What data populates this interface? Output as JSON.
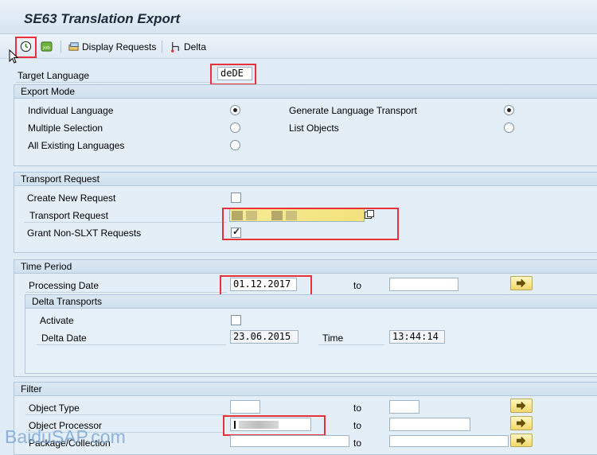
{
  "title": "SE63 Translation Export",
  "toolbar": {
    "display_requests": "Display Requests",
    "delta": "Delta",
    "job_icon_text": "Job"
  },
  "target_language": {
    "label": "Target Language",
    "value": "deDE"
  },
  "export_mode": {
    "header": "Export Mode",
    "individual_language": "Individual Language",
    "multiple_selection": "Multiple Selection",
    "all_existing_languages": "All Existing Languages",
    "generate_language_transport": "Generate Language Transport",
    "list_objects": "List Objects"
  },
  "transport_request": {
    "header": "Transport Request",
    "create_new_request": "Create New Request",
    "transport_request_label": "Transport Request",
    "grant_non_slxt": "Grant Non-SLXT Requests"
  },
  "time_period": {
    "header": "Time Period",
    "processing_date_label": "Processing Date",
    "processing_date": "01.12.2017",
    "to": "to",
    "delta_transports": {
      "header": "Delta Transports",
      "activate": "Activate",
      "delta_date_label": "Delta Date",
      "delta_date": "23.06.2015",
      "time_label": "Time",
      "time": "13:44:14"
    }
  },
  "filter": {
    "header": "Filter",
    "object_type": "Object Type",
    "object_processor": "Object Processor",
    "package_collection": "Package/Collection",
    "to": "to"
  },
  "watermark": "BaiduSAP.com"
}
